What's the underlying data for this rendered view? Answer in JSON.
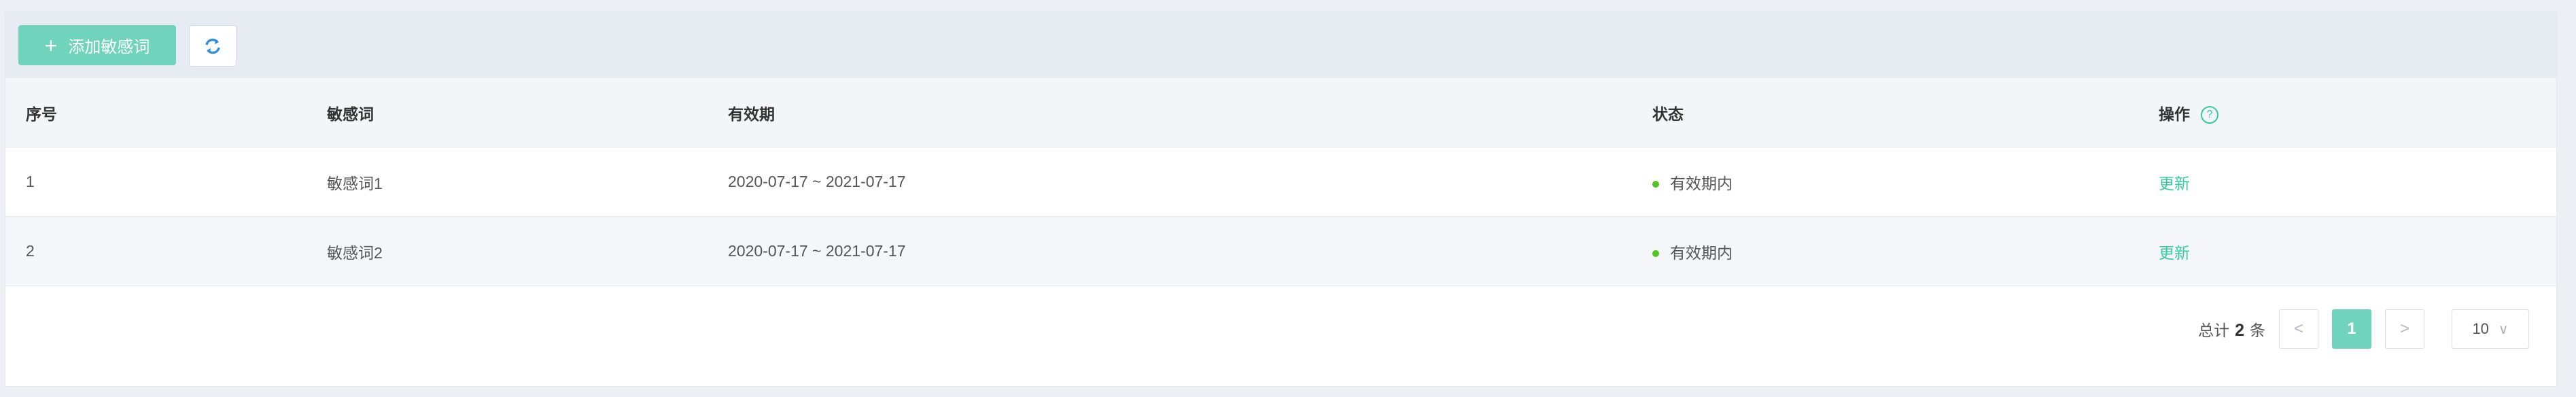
{
  "toolbar": {
    "add_icon": "plus-icon",
    "add_label": "添加敏感词",
    "refresh_icon": "refresh-icon"
  },
  "table": {
    "headers": [
      "序号",
      "敏感词",
      "有效期",
      "状态",
      "操作"
    ],
    "help_icon": "question-circle-icon",
    "help_glyph": "?",
    "rows": [
      {
        "index": "1",
        "word": "敏感词1",
        "period": "2020-07-17 ~ 2021-07-17",
        "status": "有效期内",
        "action": "更新"
      },
      {
        "index": "2",
        "word": "敏感词2",
        "period": "2020-07-17 ~ 2021-07-17",
        "status": "有效期内",
        "action": "更新"
      }
    ]
  },
  "pagination": {
    "total_prefix": "总计",
    "total_count": "2",
    "total_suffix": "条",
    "prev": "<",
    "current_page": "1",
    "next": ">",
    "page_size": "10",
    "size_chevron": "∨"
  },
  "colors": {
    "accent": "#6fd4bb",
    "link": "#37c9a0",
    "status_ok": "#52c41a"
  }
}
